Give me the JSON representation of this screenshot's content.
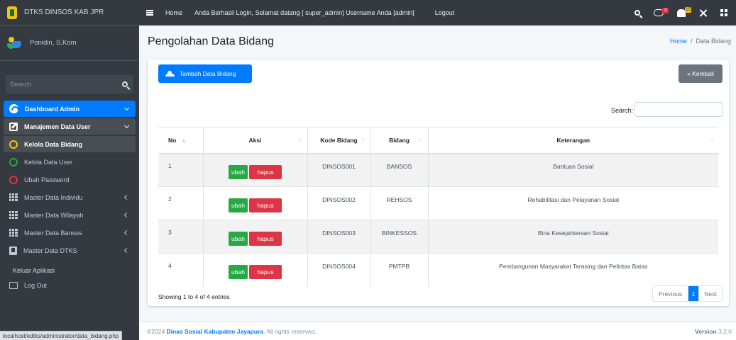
{
  "sidebar": {
    "brand": "DTKS DINSOS KAB JPR",
    "user_name": "Ponidin, S.Kom",
    "search_placeholder": "Search",
    "items": [
      {
        "label": "Dashboard Admin"
      },
      {
        "label": "Manajemen Data User"
      },
      {
        "label": "Kelola Data Bidang"
      },
      {
        "label": "Kelola Data User"
      },
      {
        "label": "Ubah Password"
      },
      {
        "label": "Master Data Individu"
      },
      {
        "label": "Master Data Wilayah"
      },
      {
        "label": "Master Data Bansos"
      },
      {
        "label": "Master Data DTKS"
      }
    ],
    "section_label": "Keluar Aplikasi",
    "logout_label": "Log Out"
  },
  "status_url": "localhost/edtks/administrator/data_bidang.php",
  "navbar": {
    "home": "Home",
    "greeting": "Anda Berhasil Login, Selamat datang [ super_admin] Username Anda [admin]",
    "logout": "Logout",
    "chat_badge": "3",
    "bell_badge": "15"
  },
  "page": {
    "title": "Pengolahan Data Bidang",
    "breadcrumb_home": "Home",
    "breadcrumb_sep": "/",
    "breadcrumb_current": "Data Bidang"
  },
  "card": {
    "add_button": "Tambah Data Bidang",
    "back_button": "« Kembali",
    "search_label": "Search:",
    "table": {
      "headers": {
        "no": "No",
        "aksi": "Aksi",
        "kode": "Kode Bidang",
        "bidang": "Bidang",
        "keterangan": "Keterangan"
      },
      "sort_icon": "↑↓",
      "edit_label": "ubah",
      "delete_label": "hapus",
      "rows": [
        {
          "no": "1",
          "kode": "DINSOS001",
          "bidang": "BANSOS",
          "keterangan": "Bantuan Sosial"
        },
        {
          "no": "2",
          "kode": "DINSOS002",
          "bidang": "REHSOS",
          "keterangan": "Rehabilitasi dan Pelayanan Sosial"
        },
        {
          "no": "3",
          "kode": "DINSOS003",
          "bidang": "BINKESSOS",
          "keterangan": "Bina Kesejahteraan Sosial"
        },
        {
          "no": "4",
          "kode": "DINSOS004",
          "bidang": "PMTPB",
          "keterangan": "Pembangunan Masyarakat Terasing dan Pelintas Batas"
        }
      ]
    },
    "entries_info": "Showing 1 to 4 of 4 entries",
    "pagination": {
      "previous": "Previous",
      "current": "1",
      "next": "Next"
    }
  },
  "footer": {
    "copyright_prefix": "©2024 ",
    "org_name": "Dinas Sosial Kabupaten Jayapura",
    "copyright_suffix": ". All rights reserved.",
    "version_label": "Version",
    "version": "3.2.0"
  },
  "colors": {
    "primary": "#007bff",
    "success": "#28a745",
    "danger": "#dc3545",
    "sidebar_bg": "#343a40"
  }
}
